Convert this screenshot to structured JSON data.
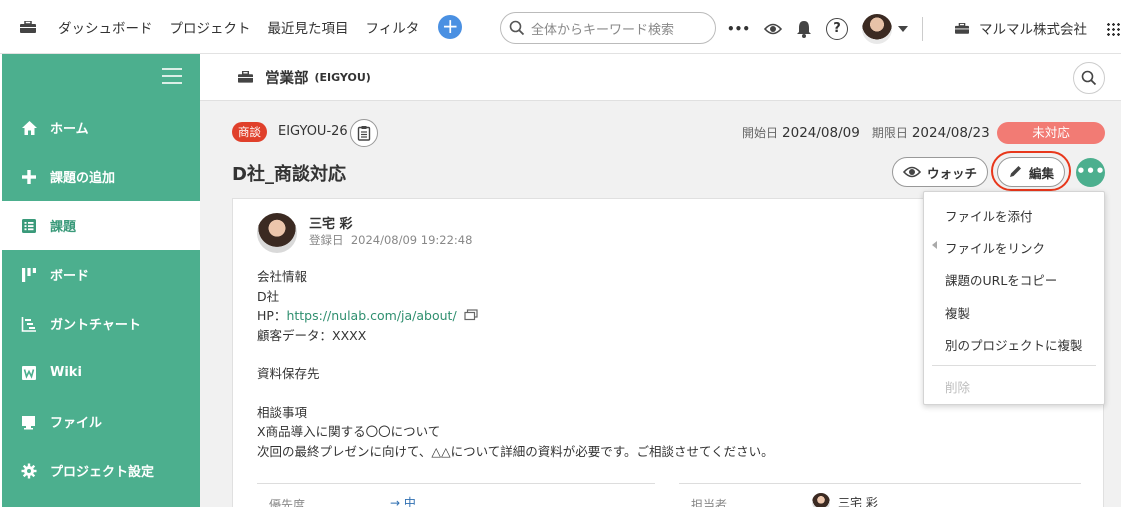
{
  "topbar": {
    "nav": [
      "ダッシュボード",
      "プロジェクト",
      "最近見た項目",
      "フィルタ"
    ],
    "add_label": "+",
    "search_placeholder": "全体からキーワード検索",
    "more_label": "•••",
    "help_label": "?",
    "org_name": "マルマル株式会社"
  },
  "sidebar": {
    "items": [
      {
        "label": "ホーム",
        "icon": "home-icon"
      },
      {
        "label": "課題の追加",
        "icon": "plus-icon"
      },
      {
        "label": "課題",
        "icon": "list-icon",
        "active": true
      },
      {
        "label": "ボード",
        "icon": "board-icon"
      },
      {
        "label": "ガントチャート",
        "icon": "gantt-icon"
      },
      {
        "label": "Wiki",
        "icon": "wiki-icon"
      },
      {
        "label": "ファイル",
        "icon": "folder-icon"
      },
      {
        "label": "プロジェクト設定",
        "icon": "gear-icon"
      }
    ]
  },
  "project": {
    "name": "営業部",
    "key": "(EIGYOU)"
  },
  "issue": {
    "type": "商談",
    "key": "EIGYOU-26",
    "start_label": "開始日",
    "start_date": "2024/08/09",
    "due_label": "期限日",
    "due_date": "2024/08/23",
    "status": "未対応",
    "title": "D社_商談対応",
    "watch_label": "ウォッチ",
    "edit_label": "編集",
    "more_label": "•••"
  },
  "comment": {
    "author": "三宅 彩",
    "date_label": "登録日",
    "date": "2024/08/09 19:22:48",
    "lines": {
      "l1": "会社情報",
      "l2": "D社",
      "hp_prefix": "HP：",
      "hp_link": "https://nulab.com/ja/about/",
      "l4": "顧客データ：XXXX",
      "l5": "資料保存先",
      "l6": "相談事項",
      "l7": "X商品導入に関する〇〇について",
      "l8": "次回の最終プレゼンに向けて、△△について詳細の資料が必要です。ご相談させてください。"
    }
  },
  "fields": {
    "priority_label": "優先度",
    "priority_value": "→ 中",
    "assignee_label": "担当者",
    "assignee_value": "三宅 彩"
  },
  "menu": {
    "items": [
      "ファイルを添付",
      "ファイルをリンク",
      "課題のURLをコピー",
      "複製",
      "別のプロジェクトに複製"
    ],
    "delete": "削除"
  },
  "colors": {
    "accent": "#4caf8e",
    "issue_type": "#e0402b",
    "status": "#f27b74",
    "highlight": "#e8371b",
    "plus_button": "#4a90e2"
  }
}
